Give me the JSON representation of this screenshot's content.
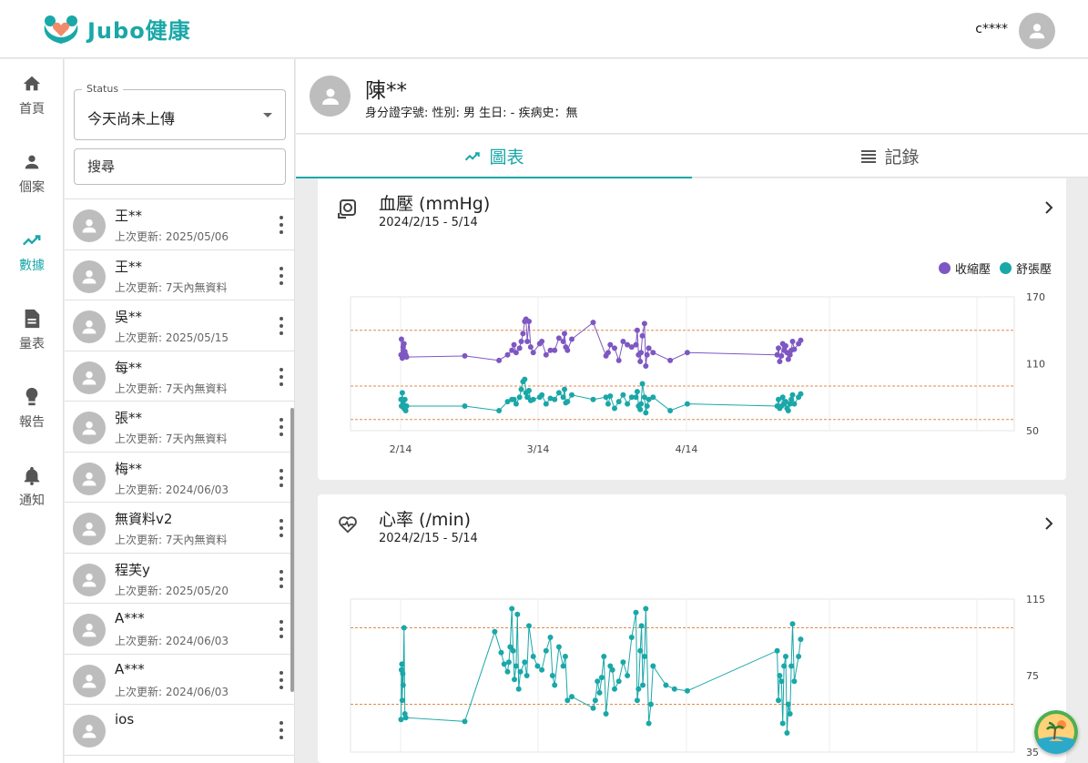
{
  "header": {
    "brand": "Jubo健康",
    "user_name": "c****",
    "avatar_icon": "account-circle-icon"
  },
  "nav": [
    {
      "label": "首頁",
      "icon": "home-icon",
      "active": false
    },
    {
      "label": "個案",
      "icon": "person-icon",
      "active": false
    },
    {
      "label": "數據",
      "icon": "trending-up-icon",
      "active": true
    },
    {
      "label": "量表",
      "icon": "document-icon",
      "active": false
    },
    {
      "label": "報告",
      "icon": "lightbulb-icon",
      "active": false
    },
    {
      "label": "通知",
      "icon": "bell-icon",
      "active": false
    }
  ],
  "filter": {
    "status_label": "Status",
    "status_value": "今天尚未上傳",
    "search_placeholder": "搜尋"
  },
  "patients": [
    {
      "name": "王**",
      "sub": "上次更新: 2025/05/06"
    },
    {
      "name": "王**",
      "sub": "上次更新: 7天內無資料"
    },
    {
      "name": "吳**",
      "sub": "上次更新: 2025/05/15"
    },
    {
      "name": "每**",
      "sub": "上次更新: 7天內無資料"
    },
    {
      "name": "張**",
      "sub": "上次更新: 7天內無資料"
    },
    {
      "name": "梅**",
      "sub": "上次更新: 2024/06/03"
    },
    {
      "name": "無資料v2",
      "sub": "上次更新: 7天內無資料"
    },
    {
      "name": "程芙y",
      "sub": "上次更新: 2025/05/20"
    },
    {
      "name": "A***",
      "sub": "上次更新: 2024/06/03"
    },
    {
      "name": "A***",
      "sub": "上次更新: 2024/06/03"
    },
    {
      "name": "ios",
      "sub": ""
    }
  ],
  "profile": {
    "name": "陳**",
    "info": "身分證字號: 性別: 男 生日: - 疾病史：無"
  },
  "tabs": [
    {
      "label": "圖表",
      "icon": "trending-up-icon",
      "active": true
    },
    {
      "label": "記錄",
      "icon": "list-icon",
      "active": false
    }
  ],
  "bp_card": {
    "title": "血壓 (mmHg)",
    "range": "2024/2/15 - 5/14",
    "legend": [
      {
        "name": "收縮壓",
        "color": "#7e57c2"
      },
      {
        "name": "舒張壓",
        "color": "#1aa7a8"
      }
    ]
  },
  "hr_card": {
    "title": "心率 (/min)",
    "range": "2024/2/15 - 5/14"
  },
  "chart_data": [
    {
      "type": "line",
      "title": "血壓 (mmHg)",
      "x_ticks": [
        "2/14",
        "3/14",
        "4/14"
      ],
      "y_ticks": [
        170,
        110,
        50
      ],
      "ylim": [
        50,
        170
      ],
      "reference_lines": [
        140,
        90,
        60
      ],
      "series": [
        {
          "name": "收縮壓",
          "color": "#7e57c2",
          "x": [
            0.1,
            0.2,
            0.4,
            0.6,
            0.8,
            1,
            1.2,
            1.4,
            15,
            23,
            25,
            26,
            26.5,
            27,
            27.8,
            28.2,
            28.6,
            29,
            29.3,
            29.6,
            30,
            30.4,
            31,
            32.5,
            33,
            34,
            35,
            36,
            37,
            38,
            38.3,
            38.6,
            39,
            40,
            45,
            48,
            48.5,
            49,
            50,
            51,
            52,
            53,
            54,
            55,
            55.3,
            55.6,
            56,
            56.2,
            56.5,
            57,
            57.3,
            57.6,
            58,
            59,
            63,
            67,
            88,
            88.3,
            88.6,
            89,
            89.3,
            89.6,
            90,
            90.3,
            90.6,
            91,
            91.3,
            91.6,
            92,
            93,
            93.5
          ],
          "y": [
            118,
            132,
            115,
            125,
            128,
            121,
            118,
            116,
            117,
            113,
            118,
            122,
            127,
            120,
            124,
            130,
            137,
            148,
            150,
            130,
            148,
            125,
            120,
            128,
            130,
            118,
            122,
            122,
            133,
            130,
            137,
            125,
            122,
            132,
            147,
            117,
            120,
            127,
            124,
            113,
            130,
            127,
            125,
            127,
            140,
            118,
            112,
            120,
            135,
            146,
            108,
            118,
            124,
            120,
            113,
            120,
            118,
            124,
            112,
            117,
            128,
            122,
            126,
            120,
            114,
            118,
            122,
            130,
            123,
            128,
            131
          ],
          "y_min": [
            118,
            122,
            115,
            125,
            128,
            121,
            118,
            116,
            117,
            113,
            118,
            122,
            127,
            120,
            124,
            130,
            137,
            148,
            150,
            130,
            148,
            125,
            120,
            128,
            130,
            118,
            122,
            122,
            133,
            130,
            137,
            125,
            122,
            132,
            147,
            117,
            120,
            127,
            124,
            113,
            130,
            127,
            125,
            127,
            140,
            118,
            112,
            120,
            135,
            146,
            108,
            118,
            124,
            120,
            113,
            120,
            118,
            124,
            112,
            117,
            128,
            122,
            126,
            120,
            114,
            118,
            122,
            130,
            123,
            128,
            131
          ]
        },
        {
          "name": "舒張壓",
          "color": "#1aa7a8",
          "x": [
            0.1,
            0.2,
            0.4,
            0.6,
            0.8,
            1,
            1.2,
            1.4,
            15,
            23,
            25,
            26,
            26.5,
            27,
            27.8,
            28.2,
            28.6,
            29,
            29.3,
            29.6,
            30,
            30.4,
            31,
            32.5,
            33,
            34,
            35,
            36,
            37,
            38,
            38.3,
            38.6,
            39,
            40,
            45,
            48,
            48.5,
            49,
            50,
            51,
            52,
            53,
            54,
            55,
            55.3,
            55.6,
            56,
            56.2,
            56.5,
            57,
            57.3,
            57.6,
            58,
            59,
            63,
            67,
            88,
            88.3,
            88.6,
            89,
            89.3,
            89.6,
            90,
            90.3,
            90.6,
            91,
            91.3,
            91.6,
            92,
            93,
            93.5
          ],
          "y": [
            78,
            72,
            84,
            74,
            70,
            78,
            68,
            72,
            72,
            68,
            76,
            78,
            78,
            74,
            80,
            87,
            94,
            96,
            84,
            80,
            86,
            77,
            78,
            80,
            82,
            74,
            79,
            78,
            84,
            80,
            87,
            75,
            76,
            82,
            78,
            80,
            74,
            81,
            70,
            76,
            82,
            74,
            80,
            80,
            85,
            72,
            69,
            74,
            92,
            80,
            66,
            72,
            78,
            80,
            68,
            74,
            72,
            78,
            70,
            72,
            80,
            74,
            76,
            70,
            68,
            74,
            78,
            82,
            74,
            80,
            83
          ]
        }
      ]
    },
    {
      "type": "line",
      "title": "心率 (/min)",
      "x_ticks": [
        "2/14",
        "3/14",
        "4/14"
      ],
      "y_ticks": [
        115,
        75,
        35
      ],
      "ylim": [
        35,
        115
      ],
      "reference_lines": [
        100,
        60
      ],
      "series": [
        {
          "name": "心率",
          "color": "#1aa7a8",
          "x": [
            0.1,
            0.2,
            0.3,
            0.4,
            0.5,
            0.6,
            0.8,
            1,
            1.2,
            15,
            22,
            23.5,
            24.2,
            25,
            25.3,
            25.6,
            26,
            26.3,
            26.6,
            27,
            27.3,
            27.6,
            28,
            29,
            29.5,
            30,
            31,
            32,
            33,
            34,
            35,
            35.5,
            36,
            37,
            38,
            38.5,
            39,
            40,
            45,
            45.5,
            46,
            46.5,
            47,
            47.5,
            48,
            49,
            49.5,
            50,
            51,
            52,
            53,
            54,
            55,
            55.3,
            55.6,
            56,
            56.3,
            56.6,
            57,
            57.3,
            58,
            58.5,
            59,
            62,
            64,
            67,
            88,
            88.3,
            88.6,
            89,
            89.3,
            89.6,
            90,
            90.3,
            90.6,
            91,
            91.3,
            91.6,
            92,
            93,
            93.5
          ],
          "y": [
            52,
            78,
            81,
            62,
            76,
            70,
            100,
            55,
            53,
            51,
            98,
            87,
            81,
            77,
            82,
            90,
            110,
            88,
            73,
            80,
            107,
            68,
            77,
            82,
            75,
            101,
            85,
            80,
            78,
            88,
            95,
            75,
            70,
            90,
            80,
            85,
            62,
            64,
            58,
            62,
            72,
            66,
            74,
            85,
            55,
            80,
            78,
            68,
            72,
            82,
            75,
            95,
            108,
            62,
            68,
            88,
            101,
            70,
            85,
            110,
            50,
            60,
            80,
            70,
            68,
            67,
            88,
            62,
            75,
            72,
            50,
            80,
            85,
            45,
            60,
            55,
            80,
            102,
            72,
            85,
            94
          ]
        }
      ]
    }
  ]
}
